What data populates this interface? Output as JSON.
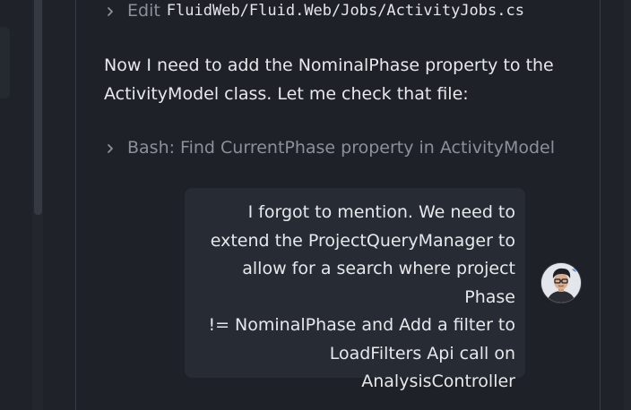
{
  "conversation": {
    "edit_tool": {
      "verb": "Edit",
      "path": "FluidWeb/Fluid.Web/Jobs/ActivityJobs.cs",
      "icon": "chevron-right-icon"
    },
    "assistant_message": "Now I need to add the NominalPhase property to the\nActivityModel class. Let me check that file:",
    "bash_tool": {
      "description": "Bash: Find CurrentPhase property in ActivityModel",
      "icon": "chevron-right-icon"
    },
    "user_message": "I forgot to mention. We need to\nextend the ProjectQueryManager to\nallow for a search where project Phase\n!= NominalPhase and Add a filter to\nLoadFilters Api call on\nAnalysisController",
    "avatar_icon": "user-avatar"
  },
  "colors": {
    "background": "#1f2228",
    "bubble": "#272b33",
    "text": "#e6e8ec",
    "muted": "#8b9099"
  }
}
